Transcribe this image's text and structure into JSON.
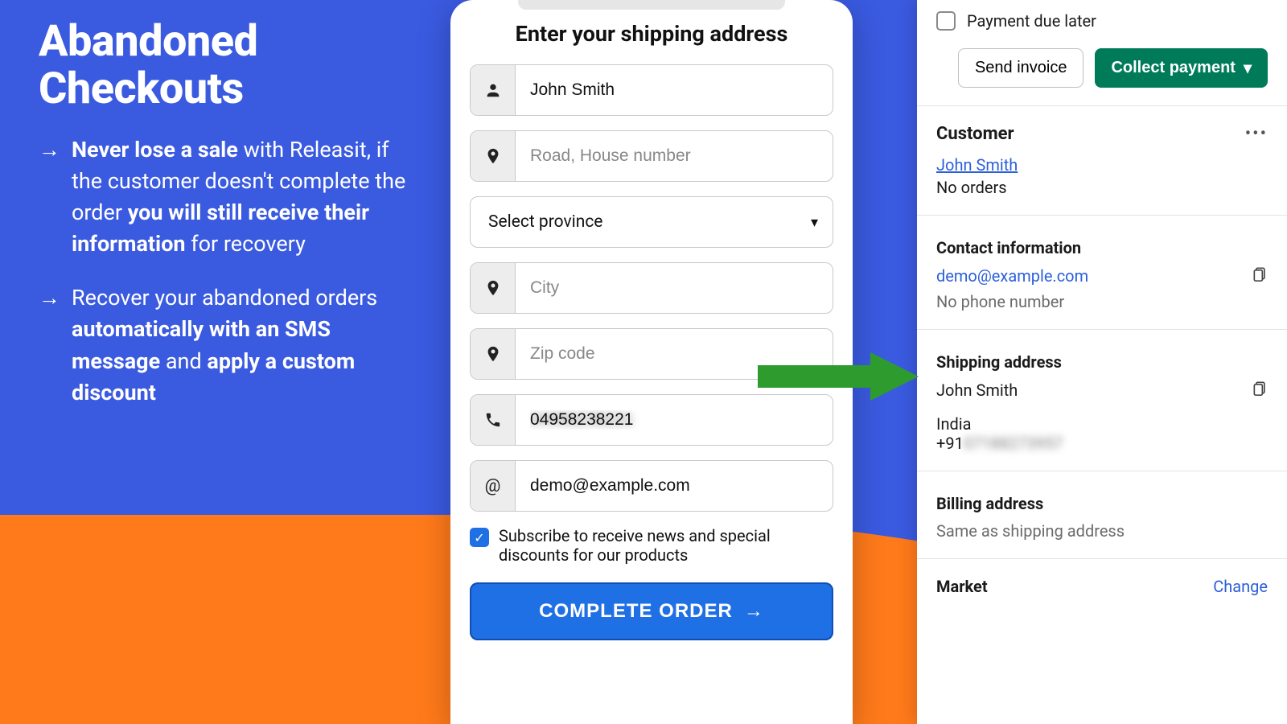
{
  "marketing": {
    "title": "Abandoned Checkouts",
    "bullet1_prefix_bold": "Never lose a sale",
    "bullet1_mid": " with Releasit, if the customer doesn't complete the order ",
    "bullet1_bold2": "you will still receive their information",
    "bullet1_suffix": " for recovery",
    "bullet2_prefix": "Recover your abandoned orders ",
    "bullet2_bold1": "automatically with an SMS message",
    "bullet2_mid": " and ",
    "bullet2_bold2": "apply a custom discount"
  },
  "form": {
    "title": "Enter your shipping address",
    "name_value": "John Smith",
    "address_placeholder": "Road, House number",
    "province_label": "Select province",
    "city_placeholder": "City",
    "zip_placeholder": "Zip code",
    "phone_value": "04958238221",
    "email_value": "demo@example.com",
    "subscribe_label": "Subscribe to receive news and special discounts for our products",
    "subscribe_checked": true,
    "submit_label": "COMPLETE ORDER"
  },
  "admin": {
    "payment_due_label": "Payment due later",
    "send_invoice_label": "Send invoice",
    "collect_payment_label": "Collect payment",
    "customer_heading": "Customer",
    "customer_name": "John Smith",
    "customer_orders": "No orders",
    "contact_heading": "Contact information",
    "contact_email": "demo@example.com",
    "contact_phone_placeholder": "No phone number",
    "shipping_heading": "Shipping address",
    "shipping_name": "John Smith",
    "shipping_country": "India",
    "shipping_phone_prefix": "+91",
    "shipping_phone_rest": "07188273957",
    "billing_heading": "Billing address",
    "billing_value": "Same as shipping address",
    "market_heading": "Market",
    "change_label": "Change"
  },
  "colors": {
    "bg_blue": "#3a5ae0",
    "bg_orange": "#ff7a1a",
    "primary_button": "#1f6fe5",
    "collect_green": "#007b5a",
    "arrow_green": "#2e9b2e"
  }
}
